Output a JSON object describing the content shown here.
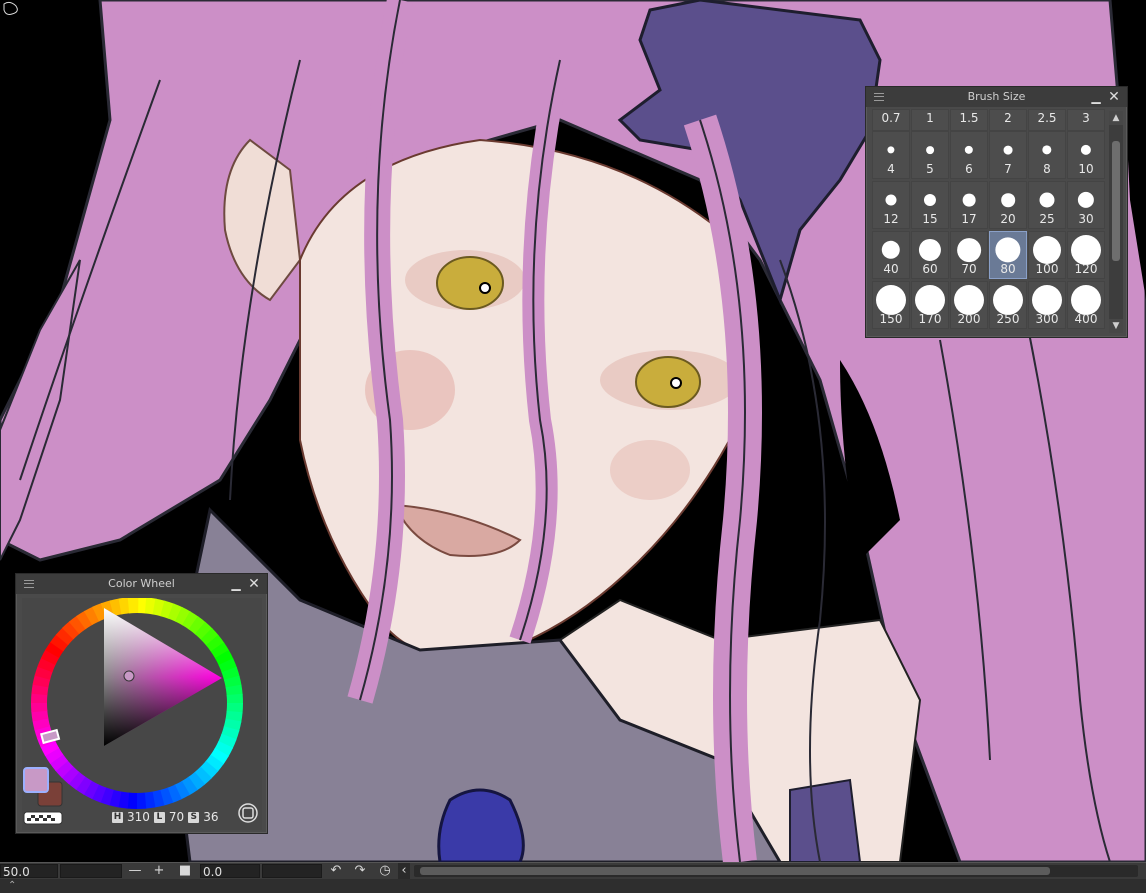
{
  "brush_panel": {
    "title": "Brush Size",
    "sizes": [
      "0.7",
      "1",
      "1.5",
      "2",
      "2.5",
      "3",
      "4",
      "5",
      "6",
      "7",
      "8",
      "10",
      "12",
      "15",
      "17",
      "20",
      "25",
      "30",
      "40",
      "60",
      "70",
      "80",
      "100",
      "120",
      "150",
      "170",
      "200",
      "250",
      "300",
      "400"
    ],
    "selected": "80"
  },
  "color_wheel": {
    "title": "Color Wheel",
    "main_color": "#c899c6",
    "sub_color": "#7a4038",
    "hls": {
      "h_label": "H",
      "h": "310",
      "l_label": "L",
      "l": "70",
      "s_label": "S",
      "s": "36"
    }
  },
  "statusbar": {
    "zoom": "50.0",
    "zoom_out": "—",
    "zoom_in": "+",
    "angle": "0.0"
  },
  "icons": [
    "menu-icon",
    "minimize-icon",
    "close-icon",
    "scroll-up-icon",
    "scroll-down-icon",
    "rotate-left-icon",
    "rotate-right-icon",
    "reset-rotation-icon",
    "collapse-icon"
  ]
}
